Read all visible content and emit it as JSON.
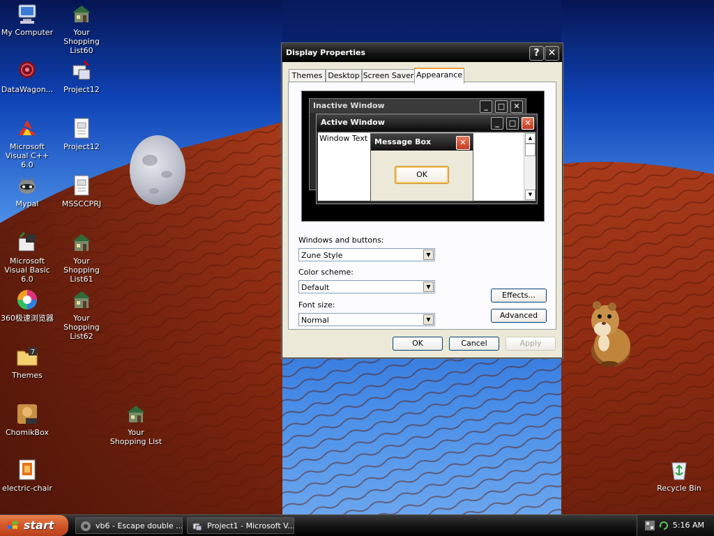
{
  "desktop": {
    "icons": [
      {
        "label": "My Computer",
        "icon": "my-computer-icon"
      },
      {
        "label": "Your Shopping List60",
        "icon": "shopping-list-icon"
      },
      {
        "label": "DataWagon...",
        "icon": "datawagon-icon"
      },
      {
        "label": "Project12",
        "icon": "project-icon"
      },
      {
        "label": "Microsoft Visual C++ 6.0",
        "icon": "visual-cpp-icon"
      },
      {
        "label": "Project12",
        "icon": "document-icon"
      },
      {
        "label": "Mypal",
        "icon": "mypal-icon"
      },
      {
        "label": "MSSCCPRJ",
        "icon": "document-icon"
      },
      {
        "label": "Microsoft Visual Basic 6.0",
        "icon": "visual-basic-icon"
      },
      {
        "label": "Your Shopping List61",
        "icon": "shopping-list-icon"
      },
      {
        "label": "360极速浏览器",
        "icon": "browser-360-icon"
      },
      {
        "label": "Your Shopping List62",
        "icon": "shopping-list-icon"
      },
      {
        "label": "Themes",
        "icon": "folder-icon"
      },
      {
        "label": "ChomikBox",
        "icon": "chomikbox-icon"
      },
      {
        "label": "Your Shopping List",
        "icon": "shopping-list-icon"
      },
      {
        "label": "electric-chair",
        "icon": "electric-chair-icon"
      },
      {
        "label": "Recycle Bin",
        "icon": "recycle-bin-icon"
      }
    ]
  },
  "dialog": {
    "title": "Display Properties",
    "help_btn": "?",
    "close_btn": "✕",
    "tabs": [
      "Themes",
      "Desktop",
      "Screen Saver",
      "Appearance"
    ],
    "preview": {
      "inactive_title": "Inactive Window",
      "active_title": "Active Window",
      "window_text": "Window Text",
      "msgbox_title": "Message Box",
      "msgbox_ok": "OK"
    },
    "windows_buttons_label": "Windows and buttons:",
    "windows_buttons_value": "Zune Style",
    "color_scheme_label": "Color scheme:",
    "color_scheme_value": "Default",
    "font_size_label": "Font size:",
    "font_size_value": "Normal",
    "effects_btn": "Effects...",
    "advanced_btn": "Advanced",
    "ok_btn": "OK",
    "cancel_btn": "Cancel",
    "apply_btn": "Apply"
  },
  "taskbar": {
    "start_label": "start",
    "tasks": [
      {
        "label": "vb6 - Escape double ...",
        "icon": "vb6-task-icon"
      },
      {
        "label": "Project1 - Microsoft V...",
        "icon": "project-task-icon"
      }
    ],
    "clock": "5:16 AM"
  },
  "colors": {
    "accent_tab": "#f0a030",
    "close_red": "#c43a1f",
    "start_orange": "#d2562a"
  }
}
